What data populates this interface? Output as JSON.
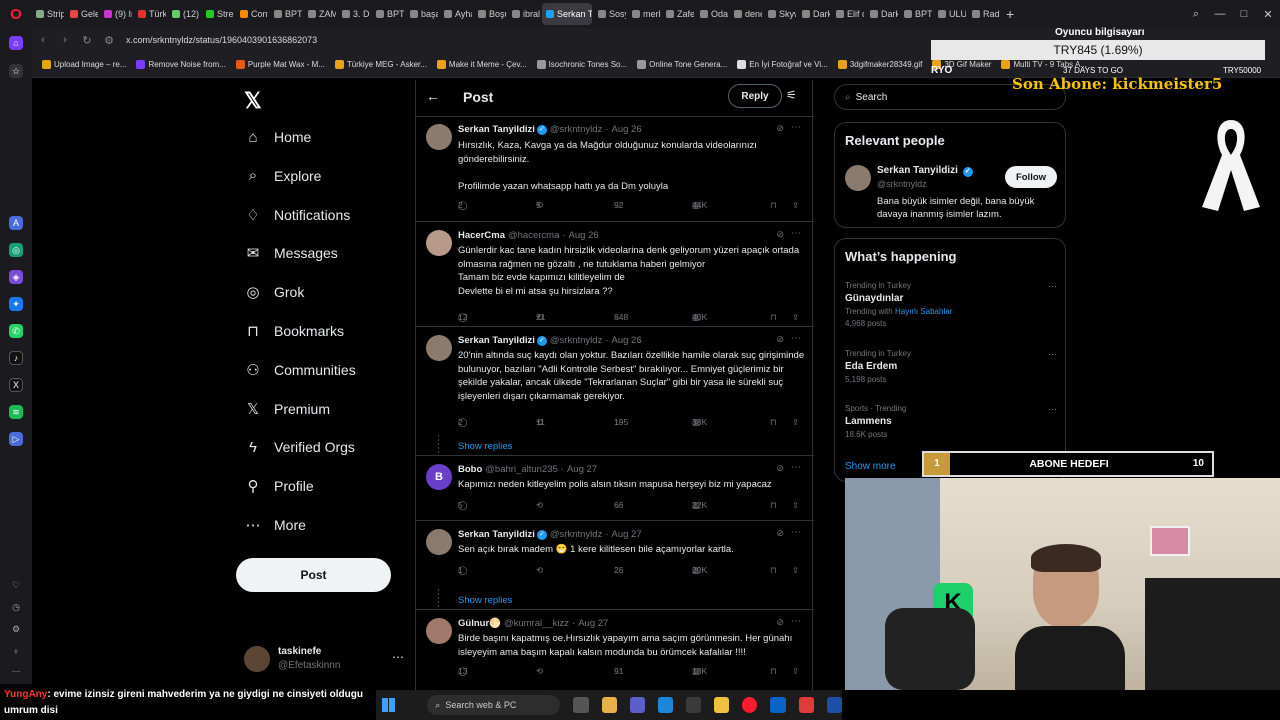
{
  "browser": {
    "tabs": [
      "Strip",
      "Gele",
      "(9) In",
      "Türk",
      "(12)",
      "Strea",
      "Conf",
      "BPT",
      "ZAM",
      "3. Dı",
      "BPT",
      "başa",
      "Ayha",
      "Boşu",
      "ibral",
      "Serkan Ta",
      "Sosy",
      "merk",
      "Zafer",
      "Odal",
      "dene",
      "Skyw",
      "Dark",
      "Elif c",
      "Dark",
      "BPT",
      "ULUS",
      "Radi"
    ],
    "active_tab": "Serkan Ta",
    "url": "x.com/srkntnyldz/status/1960403901636862073",
    "bookmarks": [
      "Upload Image – re...",
      "Remove Noise from...",
      "Purple Mat Wax - M...",
      "Türkiye MEG - Asker...",
      "Make it Meme - Çev...",
      "Isochronic Tones So...",
      "Online Tone Genera...",
      "En İyi Fotoğraf ve Vi...",
      "3dgifmaker28349.gif",
      "3D Gif Maker",
      "Multi TV - 9 Tabs A..."
    ]
  },
  "x_nav": {
    "items": [
      {
        "icon": "⌂",
        "label": "Home"
      },
      {
        "icon": "⌕",
        "label": "Explore"
      },
      {
        "icon": "♢",
        "label": "Notifications"
      },
      {
        "icon": "✉",
        "label": "Messages"
      },
      {
        "icon": "◎",
        "label": "Grok"
      },
      {
        "icon": "⊓",
        "label": "Bookmarks"
      },
      {
        "icon": "⚇",
        "label": "Communities"
      },
      {
        "icon": "𝕏",
        "label": "Premium"
      },
      {
        "icon": "ϟ",
        "label": "Verified Orgs"
      },
      {
        "icon": "⚲",
        "label": "Profile"
      },
      {
        "icon": "⋯",
        "label": "More"
      }
    ],
    "post_label": "Post",
    "account_name": "taskinefe",
    "account_handle": "@Efetaskinnn"
  },
  "main": {
    "title": "Post",
    "reply_label": "Reply",
    "show_replies": "Show replies",
    "tweets": [
      {
        "name": "Serkan Tanyildizi",
        "verified": true,
        "handle": "@srkntnyldz",
        "date": "Aug 26",
        "text": "Hırsızlık, Kaza, Kavga ya da Mağdur olduğunuz konularda videolarınızı gönderebilirsiniz.\n\nProfilimde yazan whatsapp hattı ya da Dm yoluyla",
        "replies": "2",
        "reposts": "5",
        "likes": "92",
        "views": "44K"
      },
      {
        "name": "HacerCma",
        "verified": false,
        "handle": "@hacercma",
        "date": "Aug 26",
        "text": "Günlerdir  kac tane kadın  hirsizlik videolarina denk geliyorum yüzeri apaçık ortada olmasına rağmen ne gözaltı  , ne tutuklama haberi gelmiyor\nTamam biz evde kapımızı kilitleyelim de\nDevlette bi el mi atsa şu hirsizlara ??",
        "replies": "12",
        "reposts": "21",
        "likes": "848",
        "views": "40K"
      },
      {
        "name": "Serkan Tanyildizi",
        "verified": true,
        "handle": "@srkntnyldz",
        "date": "Aug 26",
        "text": "20'nin altında suç kaydı olan yoktur. Bazıları özellikle hamile olarak suç girişiminde bulunuyor, bazıları \"Adli Kontrolle Serbest\" bırakılıyor... Emniyet güçlerimiz bir şekilde yakalar, ancak ülkede \"Tekrarlanan Suçlar\" gibi bir yasa ile sürekli suç işleyenleri dışarı çıkarmamak gerekiyor.",
        "replies": "2",
        "reposts": "11",
        "likes": "195",
        "views": "38K"
      },
      {
        "name": "Bobo",
        "verified": false,
        "handle": "@bahri_altun235",
        "date": "Aug 27",
        "text": "Kapımızı neden kitleyelim polis alsın tıksın mapusa herşeyi biz mi yapacaz",
        "replies": "5",
        "reposts": "",
        "likes": "66",
        "views": "22K"
      },
      {
        "name": "Serkan Tanyildizi",
        "verified": true,
        "handle": "@srkntnyldz",
        "date": "Aug 27",
        "text": "Sen açık bırak madem 😁 1 kere kilitlesen bile açamıyorlar kartla.",
        "replies": "1",
        "reposts": "",
        "likes": "26",
        "views": "20K"
      },
      {
        "name": "Gülnur🌕",
        "verified": false,
        "handle": "@kumral__kizz",
        "date": "Aug 27",
        "text": "Birde başını kapatmış oe.Hırsızlık yapayım ama saçım görünmesin. Her günahı isleyeyim ama başım kapalı kalsın modunda bu örümcek kafalılar  !!!!",
        "replies": "13",
        "reposts": "",
        "likes": "91",
        "views": "18K"
      }
    ]
  },
  "right": {
    "search_placeholder": "Search",
    "relevant_title": "Relevant people",
    "person_name": "Serkan Tanyildizi",
    "person_handle": "@srkntnyldz",
    "person_bio": "Bana büyük isimler değil, bana büyük davaya inanmış isimler lazım.",
    "follow_label": "Follow",
    "happening_title": "What’s happening",
    "trends": [
      {
        "context": "Trending in Turkey",
        "name": "Günaydınlar",
        "extra_prefix": "Trending with",
        "extra_link": "Hayırlı Sabahlar"
      },
      {
        "context": "Trending in Turkey",
        "name": "Eda Erdem",
        "extra": "5,198 posts"
      },
      {
        "context": "Sports · Trending",
        "name": "Lammens",
        "extra": "18.6K posts"
      }
    ],
    "gunaydinlar_posts": "4,968 posts",
    "show_more": "Show more"
  },
  "stream_overlay": {
    "title": "Oyuncu bilgisayarı",
    "ticker": "TRY845 (1.69%)",
    "ryo": "RYO",
    "days": "37 DAYS TO GO",
    "try_goal": "TRY50000",
    "son_abone": "Son Abone: kickmeister5",
    "goal_left": "1",
    "goal_label": "ABONE HEDEFI",
    "goal_right": "10",
    "chat_user": "YungAny",
    "chat_text": ": evime izinsiz gireni mahvederim ya ne giydigi ne cinsiyeti oldugu umrum disi"
  },
  "taskbar": {
    "search_label": "Search web & PC"
  },
  "colors": {
    "accent": "#1d9bf0",
    "background": "#000000",
    "text": "#e7e9ea",
    "muted": "#71767b",
    "border": "#2f3336",
    "gold": "#f5c400"
  }
}
